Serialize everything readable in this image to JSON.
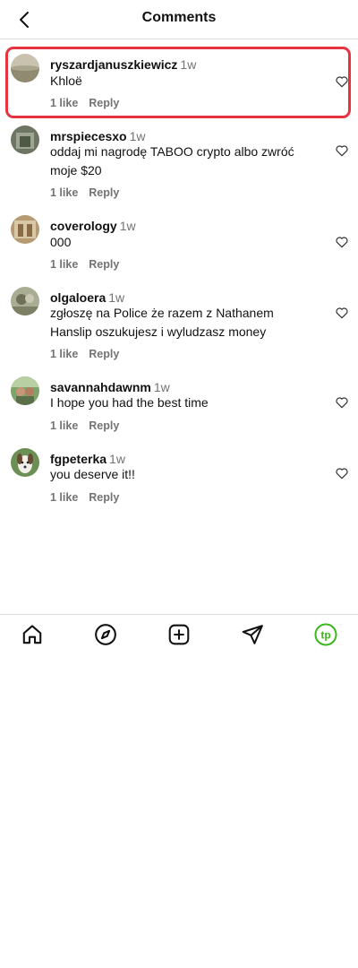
{
  "header": {
    "title": "Comments"
  },
  "comments": [
    {
      "username": "ryszardjanuszkiewicz",
      "time": "1w",
      "text": "Khloë",
      "likes": "1 like",
      "reply": "Reply",
      "highlighted": true
    },
    {
      "username": "mrspiecesxo",
      "time": "1w",
      "text": "oddaj mi nagrodę TABOO crypto albo zwróć moje $20",
      "likes": "1 like",
      "reply": "Reply"
    },
    {
      "username": "coverology",
      "time": "1w",
      "text": "000",
      "likes": "1 like",
      "reply": "Reply"
    },
    {
      "username": "olgaloera",
      "time": "1w",
      "text": "zgłoszę na Police  że razem z Nathanem Hanslip oszukujesz i wyludzasz money",
      "likes": "1 like",
      "reply": "Reply"
    },
    {
      "username": "savannahdawnm",
      "time": "1w",
      "text": "I hope you had the best time",
      "likes": "1 like",
      "reply": "Reply"
    },
    {
      "username": "fgpeterka",
      "time": "1w",
      "text": "you deserve it!!",
      "likes": "1 like",
      "reply": "Reply"
    }
  ],
  "nav": {
    "profile_text": "tp"
  },
  "colors": {
    "highlight": "#e5333f",
    "secondary_text": "#737373",
    "profile_accent": "#3db81c"
  }
}
